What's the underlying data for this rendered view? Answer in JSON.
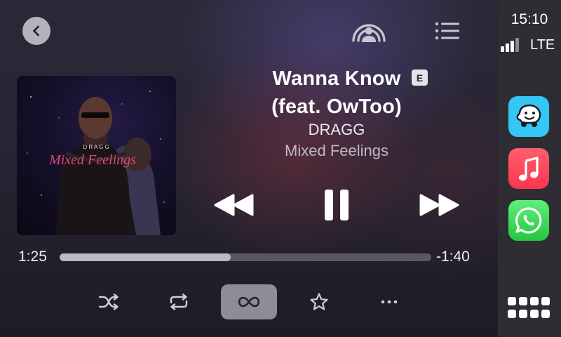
{
  "status": {
    "time": "15:10",
    "network": "LTE"
  },
  "now_playing": {
    "title_line1": "Wanna Know",
    "title_line2": "(feat. OwToo)",
    "explicit_badge": "E",
    "artist": "DRAGG",
    "album": "Mixed Feelings",
    "artwork_text": {
      "artist": "D R A G G",
      "album": "Mixed Feelings"
    }
  },
  "progress": {
    "elapsed": "1:25",
    "remaining": "-1:40",
    "fraction": 0.46
  },
  "colors": {
    "waze": "#34c6f4",
    "music": "#f93550",
    "whatsapp": "#25c63f",
    "active_button": "#8e8c96"
  },
  "icons": {
    "back": "chevron-left-icon",
    "airplay": "broadcast-icon",
    "queue": "list-icon",
    "previous": "backward-icon",
    "pause": "pause-icon",
    "next": "forward-icon",
    "shuffle": "shuffle-icon",
    "repeat": "repeat-icon",
    "autoplay": "infinity-icon",
    "favorite": "star-icon",
    "more": "ellipsis-icon",
    "apps": "grid-icon"
  }
}
